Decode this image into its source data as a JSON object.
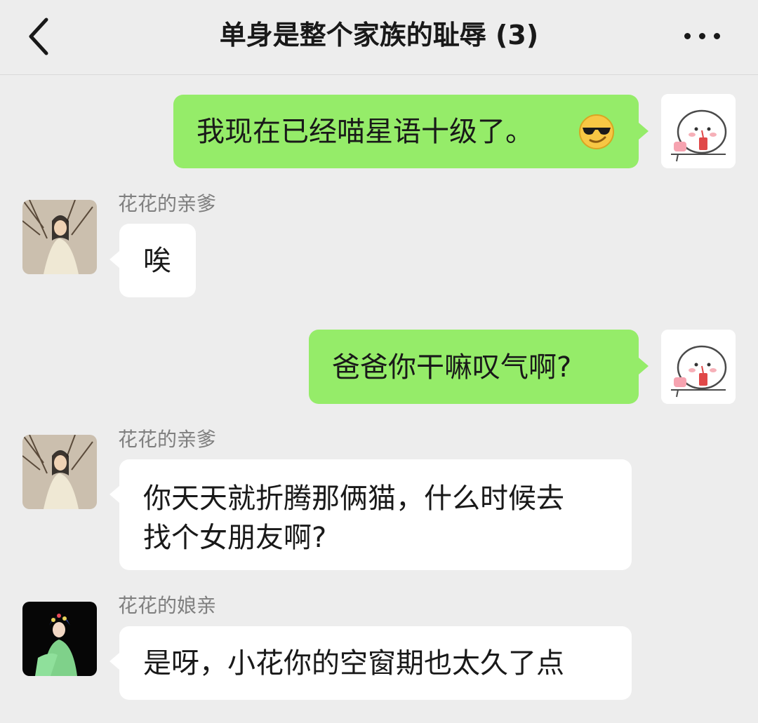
{
  "header": {
    "title": "单身是整个家族的耻辱 (3)"
  },
  "messages": [
    {
      "text": "我现在已经喵星语十级了。",
      "emoji": "sunglasses-emoji"
    },
    {
      "sender": "花花的亲爹",
      "text": "唉"
    },
    {
      "text": "爸爸你干嘛叹气啊?"
    },
    {
      "sender": "花花的亲爹",
      "text": "你天天就折腾那俩猫，什么时候去\n找个女朋友啊?"
    },
    {
      "sender": "花花的娘亲",
      "text": "是呀，小花你的空窗期也太久了点"
    }
  ],
  "colors": {
    "self_bubble": "#95ec69",
    "other_bubble": "#ffffff",
    "background": "#ededed"
  }
}
